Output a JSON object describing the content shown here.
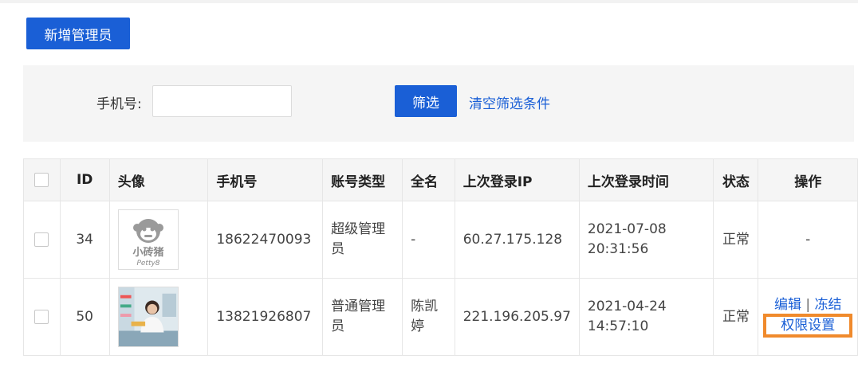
{
  "toolbar": {
    "add_label": "新增管理员"
  },
  "filter": {
    "phone_label": "手机号:",
    "phone_value": "",
    "filter_label": "筛选",
    "clear_label": "清空筛选条件"
  },
  "table": {
    "headers": [
      "ID",
      "头像",
      "手机号",
      "账号类型",
      "全名",
      "上次登录IP",
      "上次登录时间",
      "状态",
      "操作"
    ],
    "rows": [
      {
        "id": "34",
        "avatar": "logo-avatar",
        "avatar_text": "小砖猪",
        "avatar_sub": "Petty8",
        "phone": "18622470093",
        "type": "超级管理员",
        "name": "-",
        "ip": "60.27.175.128",
        "time": "2021-07-08 20:31:56",
        "status": "正常",
        "ops": "-"
      },
      {
        "id": "50",
        "avatar": "photo-avatar",
        "phone": "13821926807",
        "type": "普通管理员",
        "name": "陈凯婷",
        "ip": "221.196.205.97",
        "time": "2021-04-24 14:57:10",
        "status": "正常",
        "ops_edit": "编辑",
        "ops_sep": "|",
        "ops_freeze": "冻结",
        "ops_perm": "权限设置"
      }
    ]
  },
  "colors": {
    "accent": "#1a5fd6",
    "highlight": "#f08a2c"
  }
}
